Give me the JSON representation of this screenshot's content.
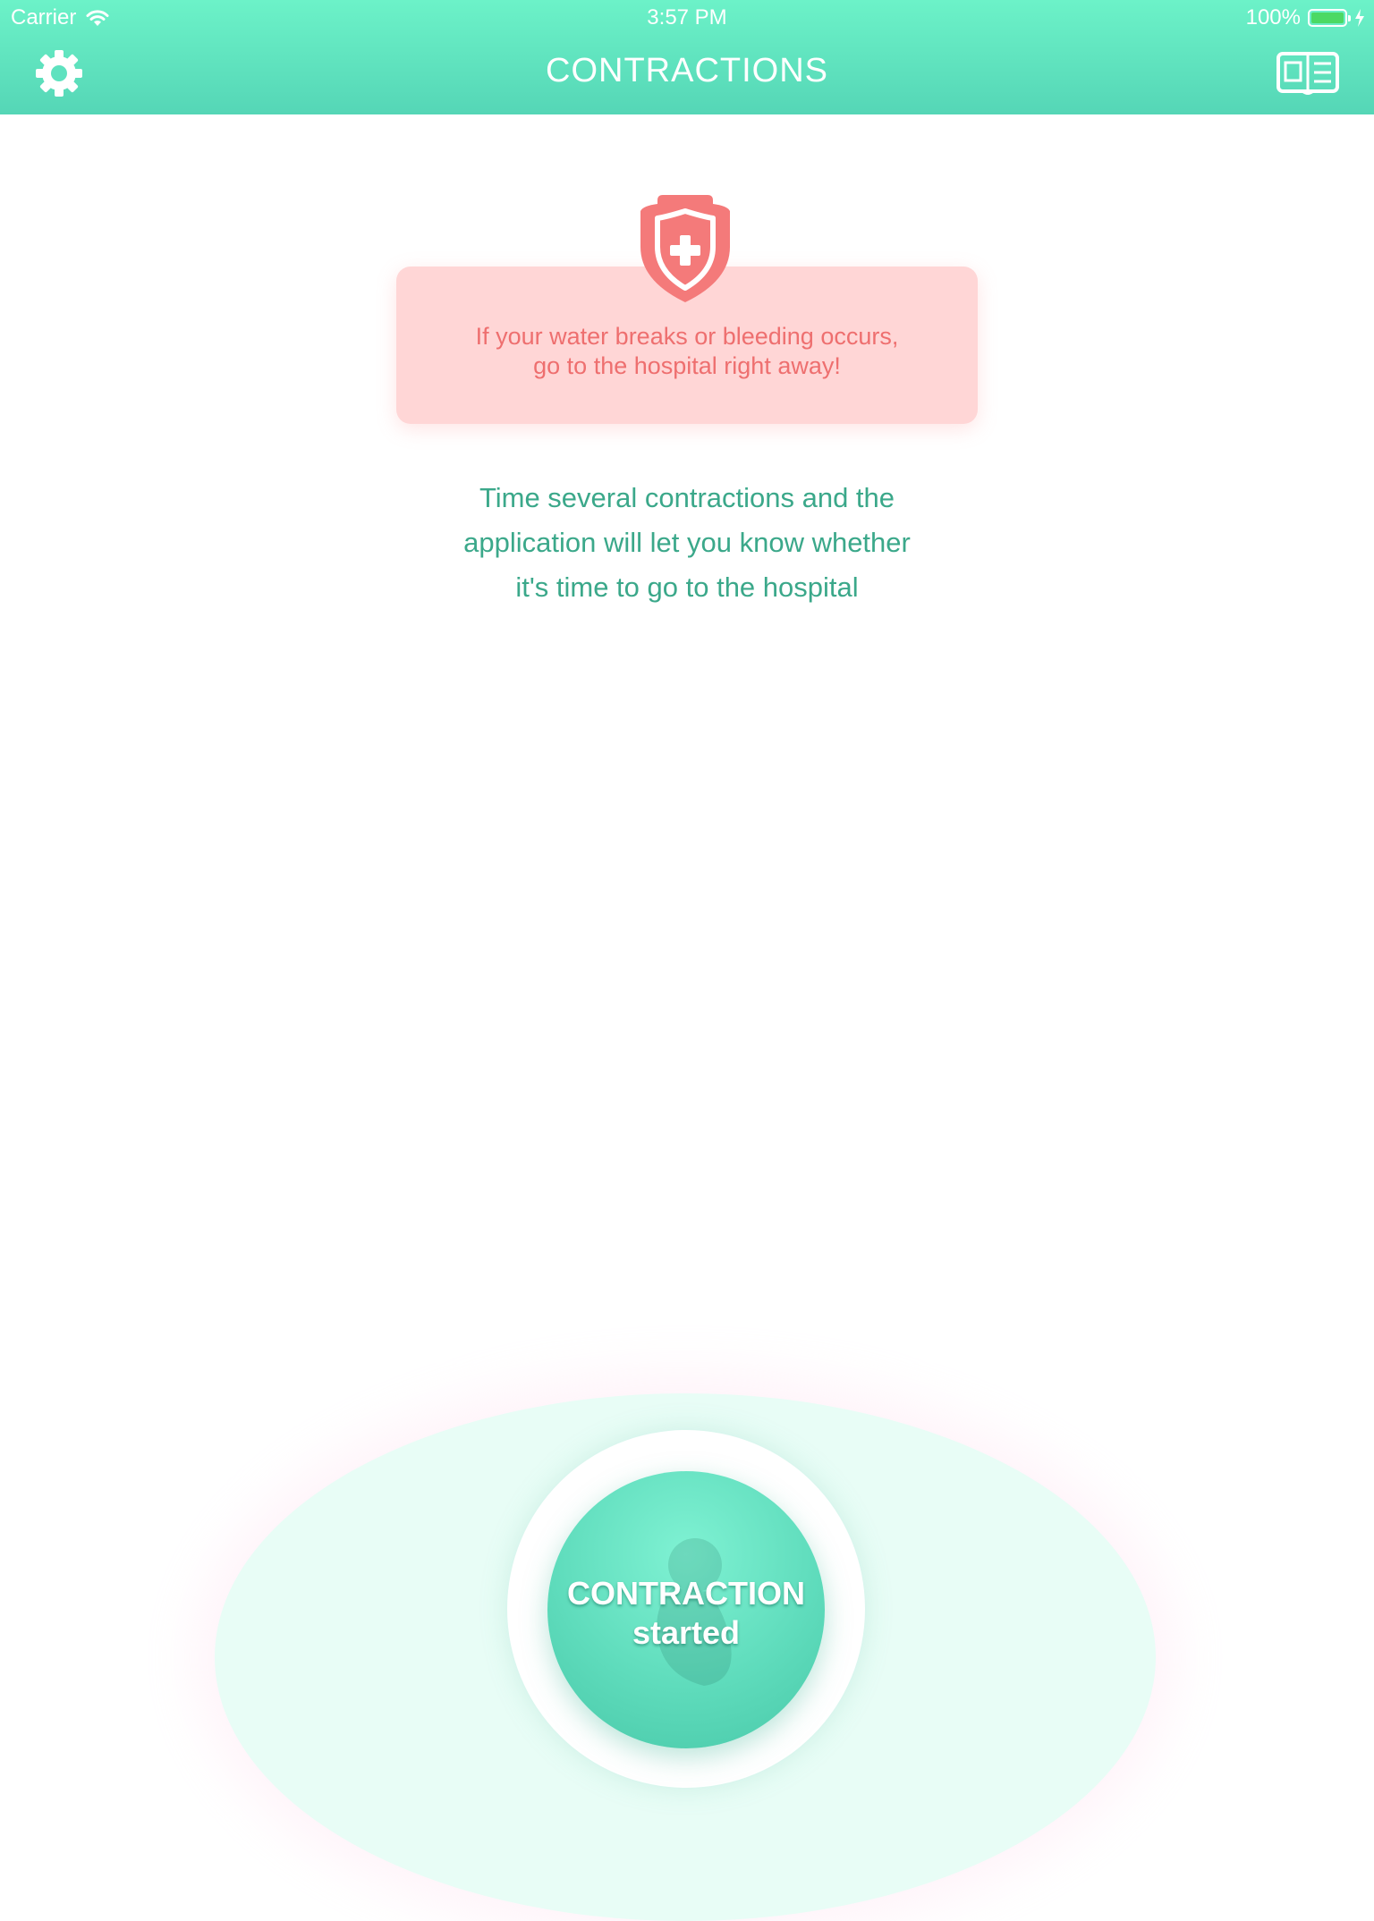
{
  "status_bar": {
    "carrier": "Carrier",
    "time": "3:57 PM",
    "battery": "100%"
  },
  "header": {
    "title": "CONTRACTIONS",
    "left_icon": "gear-icon",
    "right_icon": "book-icon"
  },
  "warning": {
    "icon": "shield-cross-icon",
    "line1": "If your water breaks or bleeding occurs,",
    "line2": "go to the hospital right away!"
  },
  "hint": {
    "line1": "Time several contractions and the",
    "line2": "application will let you know whether",
    "line3": "it's time to go to the hospital"
  },
  "start_button": {
    "line1": "CONTRACTION",
    "line2": "started"
  },
  "colors": {
    "header_gradient_top": "#6cf2c8",
    "header_gradient_bottom": "#55d6b6",
    "warning_bg": "#ffd6d6",
    "warning_text": "#ee6f6f",
    "hint_text": "#3ba88a",
    "button": "#5fdcbc"
  }
}
